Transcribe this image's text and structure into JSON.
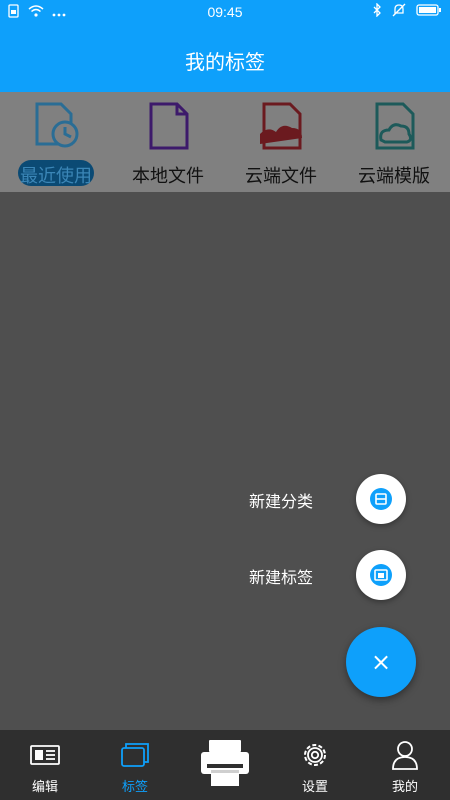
{
  "status_bar": {
    "time": "09:45"
  },
  "header": {
    "title": "我的标签"
  },
  "categories": [
    {
      "label": "最近使用",
      "icon": "recent-file-icon",
      "color": "#2a6d95",
      "active": true
    },
    {
      "label": "本地文件",
      "icon": "local-file-icon",
      "color": "#3d1a6b"
    },
    {
      "label": "云端文件",
      "icon": "cloud-file-icon",
      "color": "#6b1a1f"
    },
    {
      "label": "云端模版",
      "icon": "cloud-template-icon",
      "color": "#1d5a5a"
    }
  ],
  "fab_menu": {
    "new_category": "新建分类",
    "new_label": "新建标签",
    "close_symbol": "×"
  },
  "bottom_nav": [
    {
      "label": "编辑",
      "icon": "edit-icon"
    },
    {
      "label": "标签",
      "icon": "labels-icon",
      "active": true
    },
    {
      "label": "设置",
      "icon": "gear-icon"
    },
    {
      "label": "我的",
      "icon": "user-icon"
    }
  ],
  "colors": {
    "accent": "#0ea0fb",
    "nav_bg": "#2f2f2f",
    "overlay": "#4f4f4f"
  }
}
